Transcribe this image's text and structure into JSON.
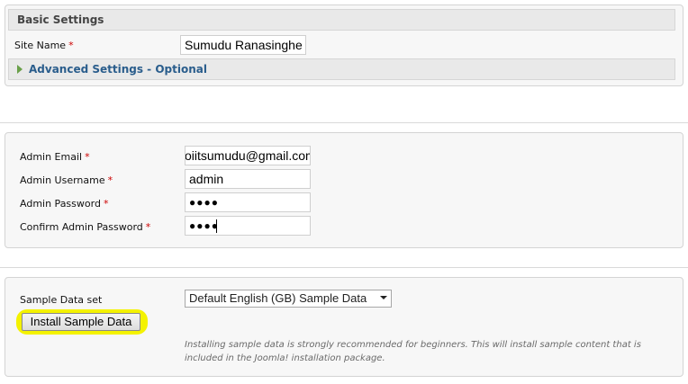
{
  "basic_settings": {
    "title": "Basic Settings",
    "site_name_label": "Site Name",
    "required_marker": "*",
    "site_name_value": "Sumudu Ranasinghe",
    "advanced_label": "Advanced Settings - Optional"
  },
  "admin": {
    "email_label": "Admin Email",
    "email_value": "oiitsumudu@gmail.com",
    "username_label": "Admin Username",
    "username_value": "admin",
    "password_label": "Admin Password",
    "password_value": "●●●●",
    "confirm_label": "Confirm Admin Password",
    "confirm_value": "●●●●"
  },
  "sample": {
    "label": "Sample Data set",
    "selected_option": "Default English (GB) Sample Data",
    "install_button": "Install Sample Data",
    "note": "Installing sample data is strongly recommended for beginners. This will install sample content that is included in the Joomla! installation package."
  },
  "colors": {
    "highlight": "#f4f200",
    "required": "#cc0000",
    "link": "#2a5d8c",
    "triangle": "#6aa04a"
  }
}
